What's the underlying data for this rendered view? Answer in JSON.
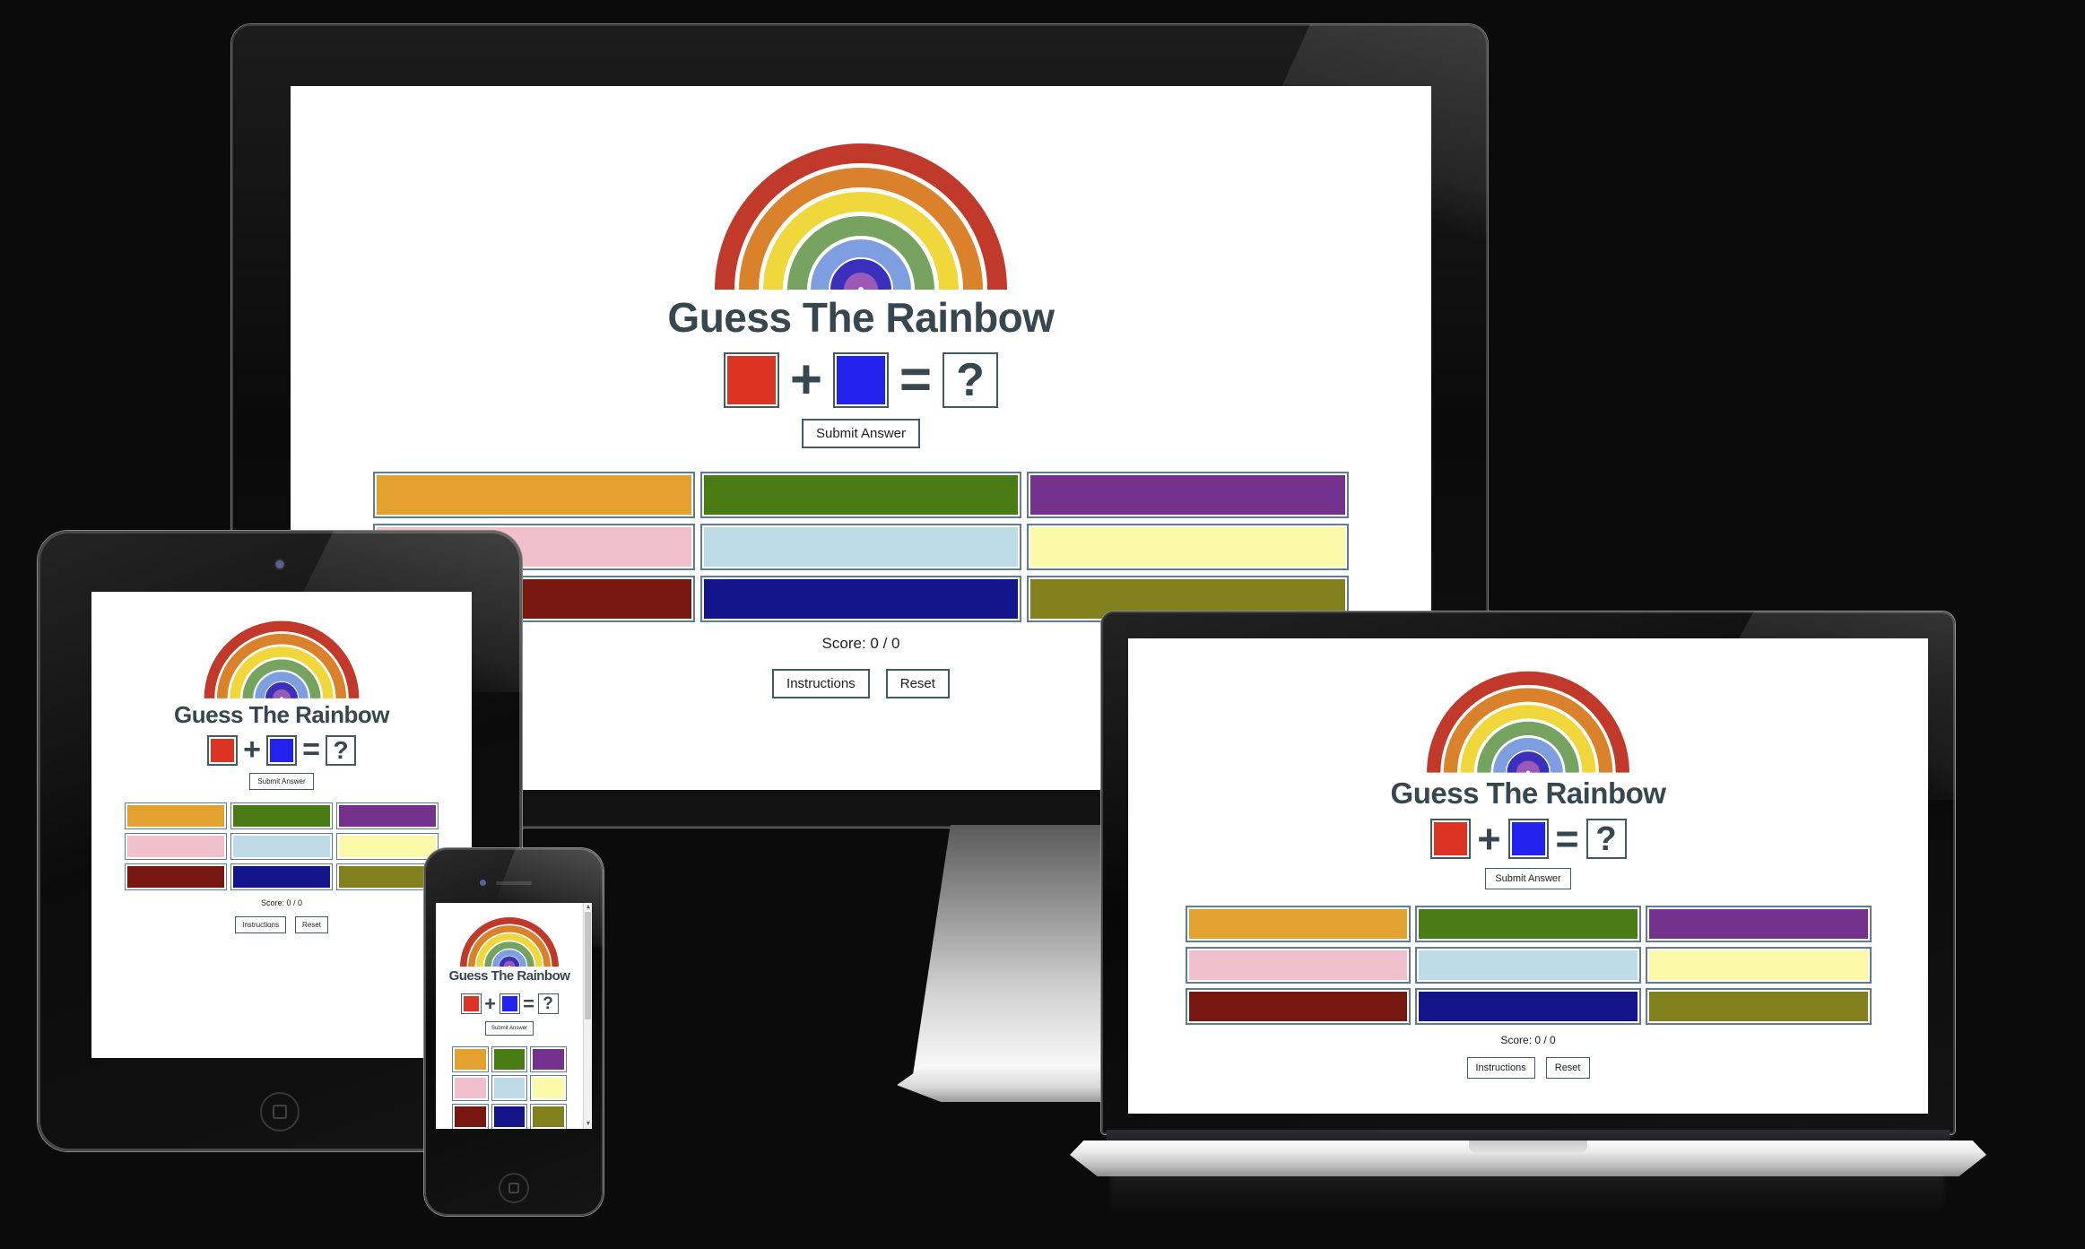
{
  "app": {
    "title": "Guess The Rainbow",
    "equation": {
      "left_color": "#dd3322",
      "operator_plus": "+",
      "right_color": "#2222ee",
      "operator_equals": "=",
      "result_placeholder": "?"
    },
    "submit_label": "Submit Answer",
    "score_label": "Score: 0 / 0",
    "instructions_label": "Instructions",
    "reset_label": "Reset",
    "rainbow_colors": [
      "#c0392b",
      "#d9822b",
      "#f0d83c",
      "#77a361",
      "#7d9fe0",
      "#3b2fbe",
      "#9b59b6"
    ],
    "palette": [
      {
        "name": "goldenrod",
        "hex": "#e3a12f"
      },
      {
        "name": "forest-green",
        "hex": "#4a7c16"
      },
      {
        "name": "purple",
        "hex": "#75318e"
      },
      {
        "name": "pink",
        "hex": "#f0c0cd"
      },
      {
        "name": "light-blue",
        "hex": "#bedbe8"
      },
      {
        "name": "light-yellow",
        "hex": "#fbfaa8"
      },
      {
        "name": "dark-red",
        "hex": "#761710"
      },
      {
        "name": "navy",
        "hex": "#14158a"
      },
      {
        "name": "olive",
        "hex": "#82801d"
      }
    ]
  },
  "devices": {
    "desktop": "desktop-monitor",
    "tablet": "tablet",
    "phone": "smartphone",
    "laptop": "laptop"
  }
}
